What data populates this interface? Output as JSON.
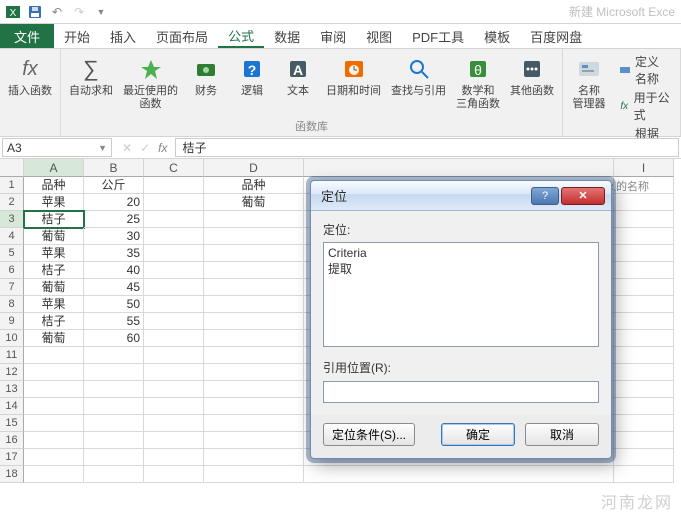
{
  "app_title": "新建 Microsoft Exce",
  "tabs": {
    "file": "文件",
    "home": "开始",
    "insert": "插入",
    "layout": "页面布局",
    "formula": "公式",
    "data": "数据",
    "review": "审阅",
    "view": "视图",
    "pdf": "PDF工具",
    "template": "模板",
    "baidu": "百度网盘"
  },
  "ribbon": {
    "insert_fn": "插入函数",
    "autosum": "自动求和",
    "recent": "最近使用的\n函数",
    "financial": "财务",
    "logical": "逻辑",
    "text": "文本",
    "datetime": "日期和时间",
    "lookup": "查找与引用",
    "math": "数学和\n三角函数",
    "more": "其他函数",
    "name_mgr": "名称\n管理器",
    "def_name": "定义名称",
    "use_in_formula": "用于公式",
    "create_from_sel": "根据所选内",
    "group_funclib": "函数库",
    "group_names": "定义的名称"
  },
  "name_box": "A3",
  "formula_value": "桔子",
  "columns": [
    "A",
    "B",
    "C",
    "D"
  ],
  "column_I": "I",
  "sheet": {
    "r1": {
      "A": "品种",
      "B": "公斤",
      "D": "品种"
    },
    "r2": {
      "A": "苹果",
      "B": "20",
      "D": "葡萄"
    },
    "r3": {
      "A": "桔子",
      "B": "25"
    },
    "r4": {
      "A": "葡萄",
      "B": "30"
    },
    "r5": {
      "A": "苹果",
      "B": "35"
    },
    "r6": {
      "A": "桔子",
      "B": "40"
    },
    "r7": {
      "A": "葡萄",
      "B": "45"
    },
    "r8": {
      "A": "苹果",
      "B": "50"
    },
    "r9": {
      "A": "桔子",
      "B": "55"
    },
    "r10": {
      "A": "葡萄",
      "B": "60"
    }
  },
  "dialog": {
    "title": "定位",
    "goto_label": "定位:",
    "list": {
      "item1": "Criteria",
      "item2": "提取"
    },
    "ref_label": "引用位置(R):",
    "ref_value": "",
    "special": "定位条件(S)...",
    "ok": "确定",
    "cancel": "取消"
  },
  "watermark": "河南龙网"
}
